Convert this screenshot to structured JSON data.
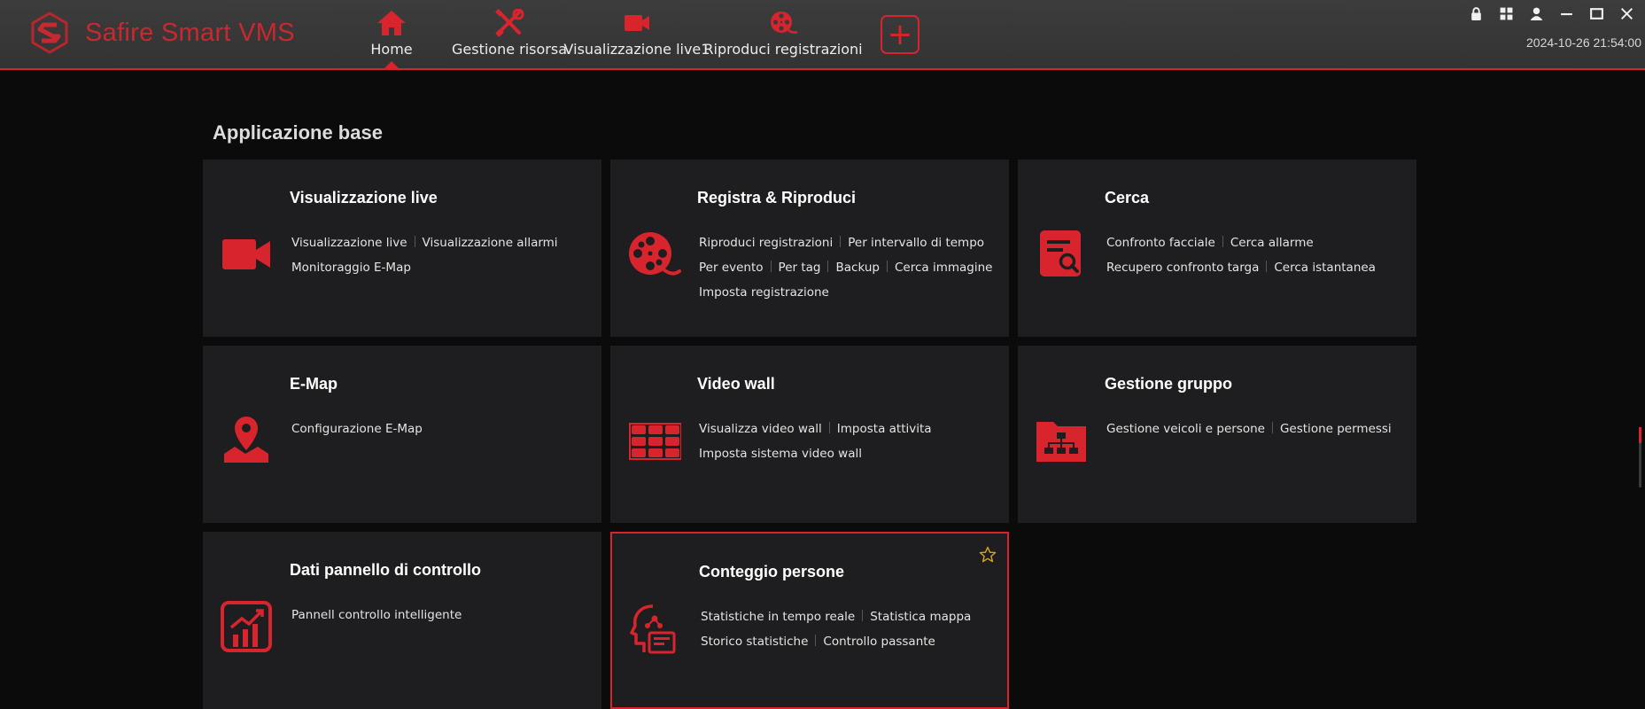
{
  "app": {
    "title": "Safire Smart VMS",
    "datetime": "2024-10-26 21:54:00"
  },
  "nav": [
    {
      "label": "Home",
      "icon": "home-icon",
      "active": true
    },
    {
      "label": "Gestione risorsa",
      "icon": "tools-icon"
    },
    {
      "label": "Visualizzazione live1",
      "icon": "video-camera-icon"
    },
    {
      "label": "Riproduci registrazioni",
      "icon": "film-reel-icon"
    }
  ],
  "add_button": "+",
  "section": {
    "title": "Applicazione base"
  },
  "cards": [
    {
      "title": "Visualizzazione live",
      "icon": "video-camera-icon",
      "links": [
        "Visualizzazione live",
        "Visualizzazione allarmi",
        "Monitoraggio E-Map"
      ]
    },
    {
      "title": "Registra & Riproduci",
      "icon": "film-reel-icon",
      "links": [
        "Riproduci registrazioni",
        "Per intervallo di tempo",
        "Per evento",
        "Per tag",
        "Backup",
        "Cerca immagine",
        "Imposta registrazione"
      ]
    },
    {
      "title": "Cerca",
      "icon": "document-search-icon",
      "links": [
        "Confronto facciale",
        "Cerca allarme",
        "Recupero confronto targa",
        "Cerca istantanea"
      ]
    },
    {
      "title": "E-Map",
      "icon": "map-pin-icon",
      "links": [
        "Configurazione E-Map"
      ]
    },
    {
      "title": "Video wall",
      "icon": "video-wall-icon",
      "links": [
        "Visualizza video wall",
        "Imposta attivita",
        "Imposta sistema video wall"
      ]
    },
    {
      "title": "Gestione gruppo",
      "icon": "org-folder-icon",
      "links": [
        "Gestione veicoli e persone",
        "Gestione permessi"
      ]
    },
    {
      "title": "Dati pannello di controllo",
      "icon": "chart-icon",
      "links": [
        "Pannell controllo intelligente"
      ]
    },
    {
      "title": "Conteggio persone",
      "icon": "head-analytics-icon",
      "links": [
        "Statistiche in tempo reale",
        "Statistica mappa",
        "Storico statistiche",
        "Controllo passante"
      ]
    }
  ],
  "colors": {
    "accent": "#d8242d",
    "card_bg": "#1e1e20",
    "page_bg": "#0b0b0b",
    "topbar_bg": "#393939",
    "star": "#d9a520"
  }
}
